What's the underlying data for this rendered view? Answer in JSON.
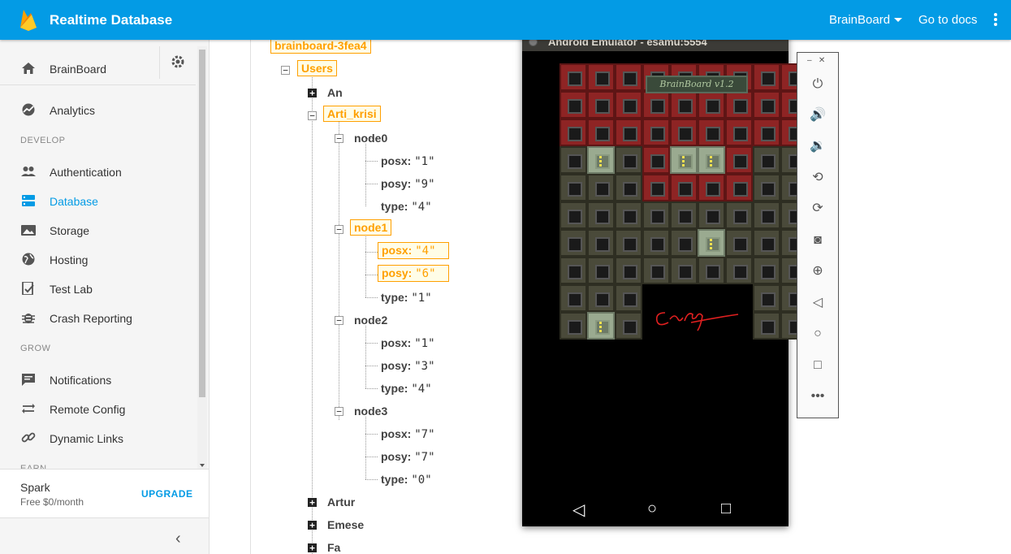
{
  "header": {
    "title": "Realtime Database",
    "project": "BrainBoard",
    "docs_link": "Go to docs",
    "accent_color": "#039be5"
  },
  "sidebar": {
    "home_label": "BrainBoard",
    "top_items": [
      {
        "label": "Analytics",
        "icon": "analytics-icon"
      }
    ],
    "develop_label": "DEVELOP",
    "develop_items": [
      {
        "label": "Authentication",
        "icon": "people-icon"
      },
      {
        "label": "Database",
        "icon": "database-icon",
        "active": true
      },
      {
        "label": "Storage",
        "icon": "image-icon"
      },
      {
        "label": "Hosting",
        "icon": "globe-icon"
      },
      {
        "label": "Test Lab",
        "icon": "checklist-icon"
      },
      {
        "label": "Crash Reporting",
        "icon": "bug-icon"
      }
    ],
    "grow_label": "GROW",
    "grow_items": [
      {
        "label": "Notifications",
        "icon": "message-icon"
      },
      {
        "label": "Remote Config",
        "icon": "swap-icon"
      },
      {
        "label": "Dynamic Links",
        "icon": "link-icon"
      }
    ],
    "earn_label": "EARN",
    "plan_name": "Spark",
    "plan_price": "Free $0/month",
    "upgrade_label": "UPGRADE"
  },
  "tree": {
    "root": "brainboard-3fea4",
    "users": "Users",
    "an": "An",
    "arti": "Arti_krisi",
    "n0": {
      "name": "node0",
      "posx": "\"1\"",
      "posy": "\"9\"",
      "type": "\"4\""
    },
    "n1": {
      "name": "node1",
      "posx": "\"4\"",
      "posy": "\"6\"",
      "type": "\"1\""
    },
    "n2": {
      "name": "node2",
      "posx": "\"1\"",
      "posy": "\"3\"",
      "type": "\"4\""
    },
    "n3": {
      "name": "node3",
      "posx": "\"7\"",
      "posy": "\"7\"",
      "type": "\"0\""
    },
    "k_posx": "posx:",
    "k_posy": "posy:",
    "k_type": "type:",
    "artur": "Artur",
    "emese": "Emese",
    "fa": "Fa"
  },
  "emulator": {
    "window_title": "Android Emulator - esamu:5554",
    "game_title": "BrainBoard v1.2"
  }
}
